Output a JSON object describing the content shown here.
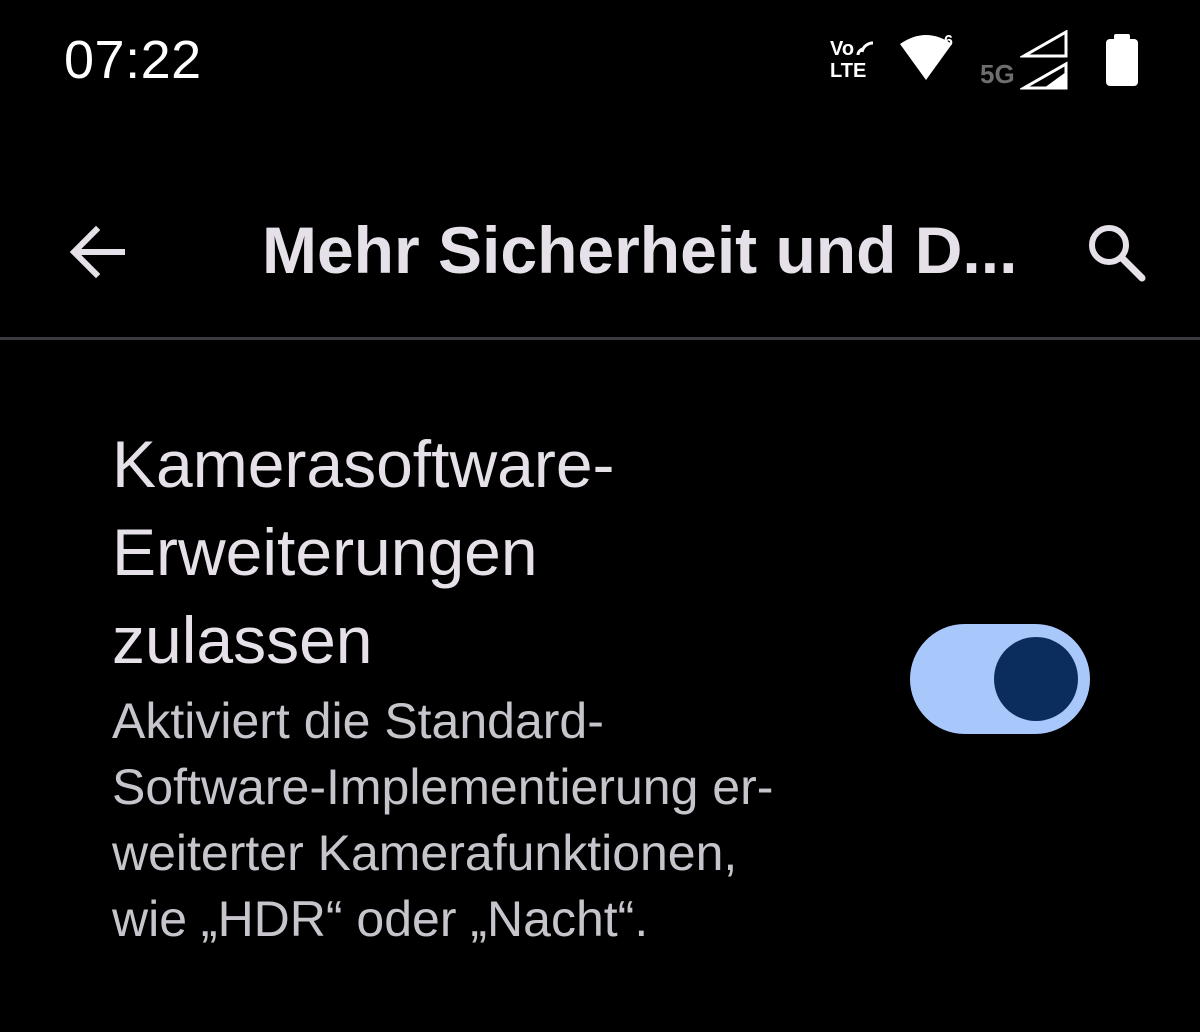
{
  "status_bar": {
    "time": "07:22",
    "volte_top": "Vo",
    "volte_bottom": "LTE",
    "wifi_badge": "6",
    "network_type": "5G",
    "icons": [
      "volte-icon",
      "wifi-icon",
      "signal-icon",
      "battery-icon"
    ]
  },
  "app_bar": {
    "title": "Mehr Sicherheit und D...",
    "back_icon": "arrow-back-icon",
    "search_icon": "search-icon"
  },
  "setting": {
    "title_lines": [
      "Kamerasoftware-",
      "Erweiterungen",
      "zulassen"
    ],
    "summary_lines": [
      "Aktiviert die Standard-",
      "Software-Implementierung er-",
      "weiterter Kamerafunktionen,",
      "wie „HDR“ oder „Nacht“."
    ],
    "toggle_on": true
  },
  "colors": {
    "background": "#000000",
    "text_primary": "#e6e1e8",
    "text_secondary": "#c8c4cc",
    "toggle_track": "#a8c7fa",
    "toggle_thumb": "#0b2d5e",
    "divider": "#3c3b42"
  }
}
